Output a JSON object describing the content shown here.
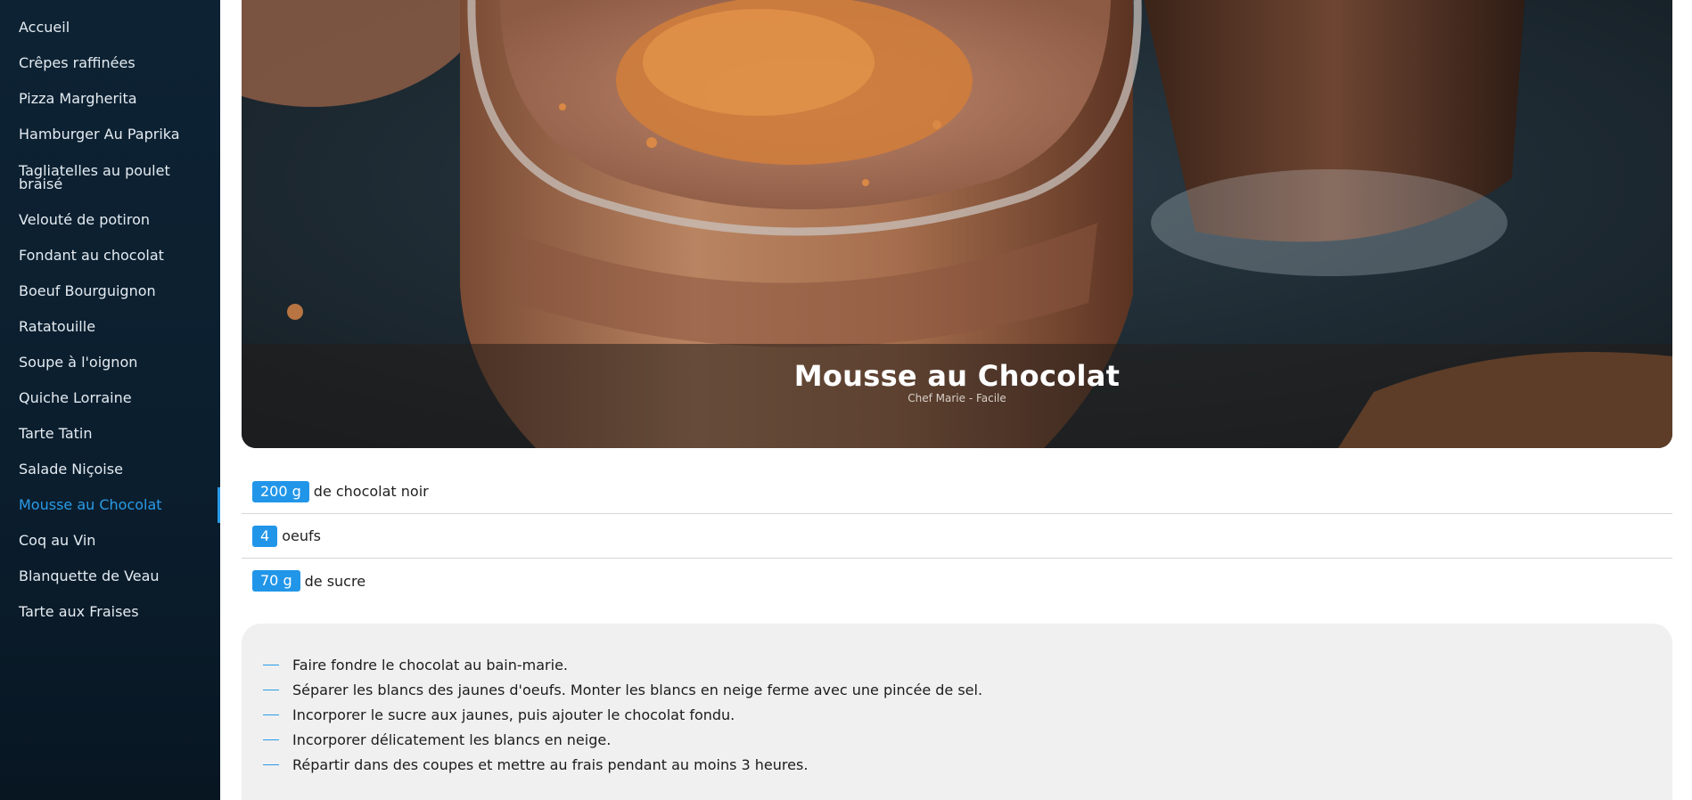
{
  "sidebar": {
    "items": [
      {
        "label": "Accueil"
      },
      {
        "label": "Crêpes raffinées"
      },
      {
        "label": "Pizza Margherita"
      },
      {
        "label": "Hamburger Au Paprika"
      },
      {
        "label": "Tagliatelles au poulet braisé"
      },
      {
        "label": "Velouté de potiron"
      },
      {
        "label": "Fondant au chocolat"
      },
      {
        "label": "Boeuf Bourguignon"
      },
      {
        "label": "Ratatouille"
      },
      {
        "label": "Soupe à l'oignon"
      },
      {
        "label": "Quiche Lorraine"
      },
      {
        "label": "Tarte Tatin"
      },
      {
        "label": "Salade Niçoise"
      },
      {
        "label": "Mousse au Chocolat"
      },
      {
        "label": "Coq au Vin"
      },
      {
        "label": "Blanquette de Veau"
      },
      {
        "label": "Tarte aux Fraises"
      }
    ],
    "active_index": 13
  },
  "recipe": {
    "title": "Mousse au Chocolat",
    "subtitle": "Chef Marie - Facile",
    "ingredients": [
      {
        "qty": "200 g",
        "name": "de chocolat noir"
      },
      {
        "qty": "4",
        "name": "oeufs"
      },
      {
        "qty": "70 g",
        "name": "de sucre"
      }
    ],
    "steps": [
      "Faire fondre le chocolat au bain-marie.",
      "Séparer les blancs des jaunes d'oeufs. Monter les blancs en neige ferme avec une pincée de sel.",
      "Incorporer le sucre aux jaunes, puis ajouter le chocolat fondu.",
      "Incorporer délicatement les blancs en neige.",
      "Répartir dans des coupes et mettre au frais pendant au moins 3 heures."
    ]
  },
  "colors": {
    "accent": "#2196e9",
    "sidebar_bg": "#0d2233",
    "steps_bg": "#f0f0f0"
  }
}
